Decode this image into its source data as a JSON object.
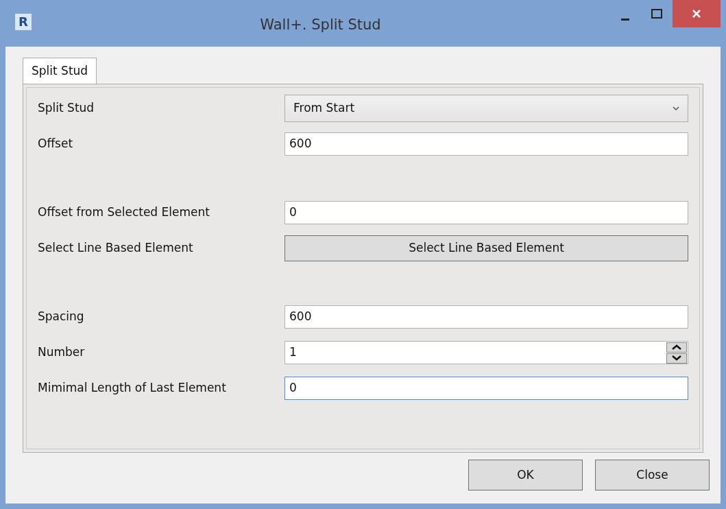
{
  "window": {
    "title": "Wall+. Split Stud",
    "app_letter": "R"
  },
  "tabs": [
    {
      "label": "Split Stud",
      "selected": true
    }
  ],
  "rows": [
    {
      "kind": "dropdown",
      "label": "Split Stud",
      "value": "From Start",
      "focused": false
    },
    {
      "kind": "text",
      "label": "Offset",
      "value": "600",
      "focused": false
    },
    {
      "kind": "spacer"
    },
    {
      "kind": "text",
      "label": "Offset from Selected Element",
      "value": "0",
      "focused": false
    },
    {
      "kind": "button",
      "label": "Select Line Based Element",
      "value": "Select Line Based Element"
    },
    {
      "kind": "spacer"
    },
    {
      "kind": "text",
      "label": "Spacing",
      "value": "600",
      "focused": false
    },
    {
      "kind": "spinner",
      "label": "Number",
      "value": "1",
      "focused": false
    },
    {
      "kind": "text",
      "label": "Mimimal Length of Last Element",
      "value": "0",
      "focused": true
    }
  ],
  "buttons": [
    "OK",
    "Close"
  ]
}
